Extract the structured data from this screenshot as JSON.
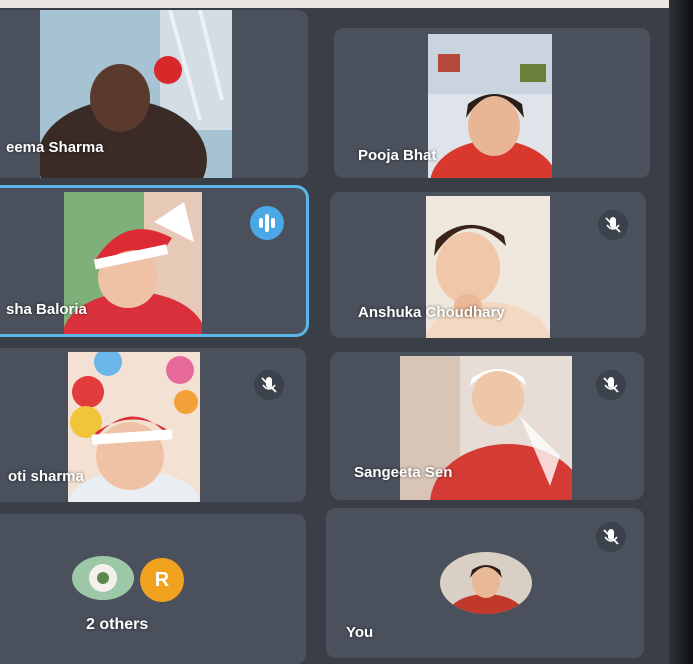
{
  "participants": [
    {
      "name": "eema Sharma"
    },
    {
      "name": "Pooja Bhat"
    },
    {
      "name": "sha Baloria"
    },
    {
      "name": "Anshuka Choudhary"
    },
    {
      "name": "oti sharma"
    },
    {
      "name": "Sangeeta Sen"
    }
  ],
  "others": {
    "label": "2 others",
    "avatar_letter": "R"
  },
  "self": {
    "label": "You"
  },
  "colors": {
    "accent": "#5ab5e8",
    "tile": "#4a515c",
    "background": "#3a3f47"
  }
}
